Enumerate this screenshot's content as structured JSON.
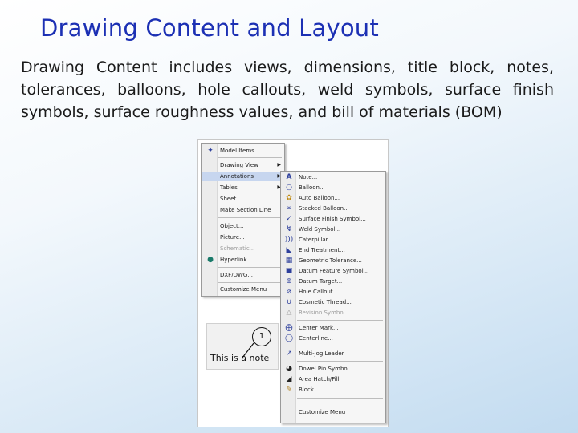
{
  "slide": {
    "title": "Drawing Content and Layout",
    "body": "Drawing Content includes views, dimensions, title block, notes, tolerances, balloons, hole callouts, weld symbols, surface finish symbols, surface roughness values, and bill of materials (BOM)"
  },
  "insert_menu": {
    "items": [
      {
        "label": "Model Items...",
        "icon": "model-items-icon"
      },
      {
        "label": "Drawing View",
        "has_submenu": true
      },
      {
        "label": "Annotations",
        "has_submenu": true,
        "highlighted": true
      },
      {
        "label": "Tables",
        "has_submenu": true
      },
      {
        "label": "Sheet..."
      },
      {
        "label": "Make Section Line"
      },
      {
        "label": "Object..."
      },
      {
        "label": "Picture..."
      },
      {
        "label": "Schematic...",
        "disabled": true
      },
      {
        "label": "Hyperlink...",
        "icon": "globe-icon"
      },
      {
        "label": "DXF/DWG..."
      },
      {
        "label": "Customize Menu"
      }
    ]
  },
  "annotations_menu": {
    "items": [
      {
        "label": "Note...",
        "icon": "note-icon"
      },
      {
        "label": "Balloon...",
        "icon": "balloon-icon"
      },
      {
        "label": "Auto Balloon...",
        "icon": "auto-balloon-icon"
      },
      {
        "label": "Stacked Balloon...",
        "icon": "stacked-balloon-icon"
      },
      {
        "label": "Surface Finish Symbol...",
        "icon": "surface-finish-icon"
      },
      {
        "label": "Weld Symbol...",
        "icon": "weld-symbol-icon"
      },
      {
        "label": "Caterpillar...",
        "icon": "caterpillar-icon"
      },
      {
        "label": "End Treatment...",
        "icon": "end-treatment-icon"
      },
      {
        "label": "Geometric Tolerance...",
        "icon": "geometric-tolerance-icon"
      },
      {
        "label": "Datum Feature Symbol...",
        "icon": "datum-feature-icon"
      },
      {
        "label": "Datum Target...",
        "icon": "datum-target-icon"
      },
      {
        "label": "Hole Callout...",
        "icon": "hole-callout-icon"
      },
      {
        "label": "Cosmetic Thread...",
        "icon": "cosmetic-thread-icon"
      },
      {
        "label": "Revision Symbol...",
        "icon": "revision-symbol-icon",
        "disabled": true
      },
      {
        "label": "Center Mark...",
        "icon": "center-mark-icon"
      },
      {
        "label": "Centerline...",
        "icon": "centerline-icon"
      },
      {
        "label": "Multi-jog Leader",
        "icon": "multi-jog-leader-icon"
      },
      {
        "label": "Dowel Pin Symbol",
        "icon": "dowel-pin-icon"
      },
      {
        "label": "Area Hatch/Fill",
        "icon": "area-hatch-icon"
      },
      {
        "label": "Block...",
        "icon": "block-icon"
      },
      {
        "label": "Customize Menu"
      }
    ]
  },
  "note_example": {
    "balloon_number": "1",
    "text": "This is a note"
  }
}
